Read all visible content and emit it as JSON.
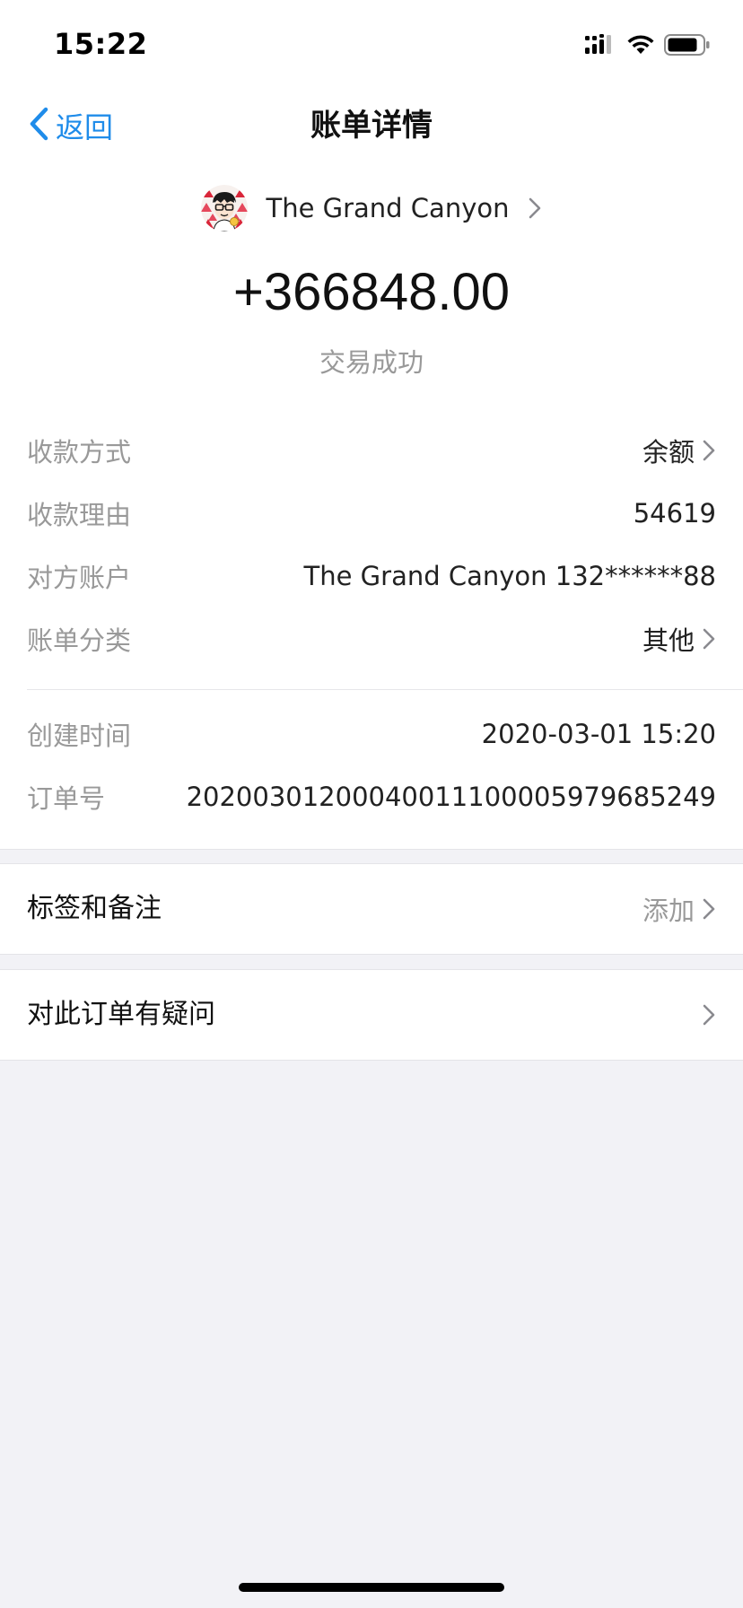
{
  "status_bar": {
    "time": "15:22"
  },
  "nav": {
    "back_label": "返回",
    "title": "账单详情"
  },
  "merchant": {
    "name": "The Grand Canyon"
  },
  "amount": "+366848.00",
  "transaction_status": "交易成功",
  "details": [
    {
      "label": "收款方式",
      "value": "余额"
    },
    {
      "label": "收款理由",
      "value": "54619"
    },
    {
      "label": "对方账户",
      "value": "The Grand Canyon 132******88"
    },
    {
      "label": "账单分类",
      "value": "其他"
    },
    {
      "label": "创建时间",
      "value": "2020-03-01 15:20"
    },
    {
      "label": "订单号",
      "value": "20200301200040011100005979685249"
    }
  ],
  "tags_section": {
    "label": "标签和备注",
    "action": "添加"
  },
  "question_section": {
    "label": "对此订单有疑问"
  },
  "icons": {
    "back": "chevron-left-icon",
    "chevron": "chevron-right-icon",
    "signal": "signal-icon",
    "wifi": "wifi-icon",
    "battery": "battery-icon",
    "avatar": "avatar-cartoon-face"
  },
  "colors": {
    "accent": "#1f8cea",
    "background": "#f2f2f6",
    "secondary_text": "#999999"
  }
}
